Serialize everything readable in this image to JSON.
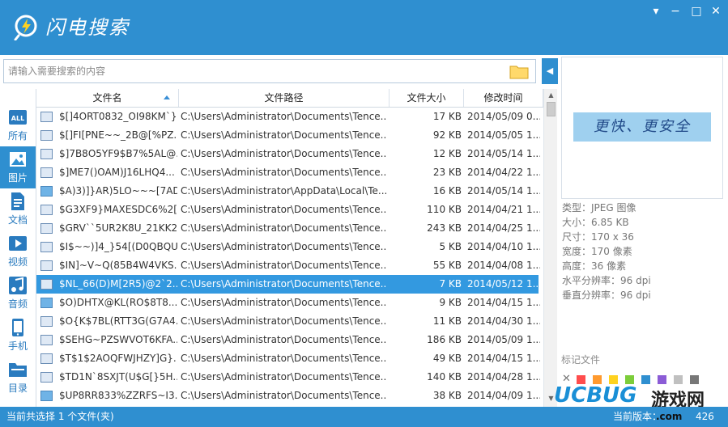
{
  "app": {
    "title": "闪电搜索"
  },
  "search": {
    "placeholder": "请输入需要搜索的内容"
  },
  "sidebar": {
    "items": [
      {
        "label": "所有",
        "icon": "all-icon"
      },
      {
        "label": "图片",
        "icon": "image-icon"
      },
      {
        "label": "文档",
        "icon": "document-icon"
      },
      {
        "label": "视频",
        "icon": "video-icon"
      },
      {
        "label": "音频",
        "icon": "audio-icon"
      },
      {
        "label": "手机",
        "icon": "phone-icon"
      },
      {
        "label": "目录",
        "icon": "folder-icon"
      }
    ],
    "active": "图片"
  },
  "table": {
    "columns": [
      "文件名",
      "文件路径",
      "文件大小",
      "修改时间"
    ],
    "sort_column": "文件名",
    "selected_row": 9,
    "rows": [
      {
        "name": "$[]4ORT0832_OI98KM`}...",
        "path": "C:\\Users\\Administrator\\Documents\\Tence...",
        "size": "17 KB",
        "date": "2014/05/09 0...",
        "type": "file"
      },
      {
        "name": "$[]FI[PNE~~_2B@[%PZ...",
        "path": "C:\\Users\\Administrator\\Documents\\Tence...",
        "size": "92 KB",
        "date": "2014/05/05 1...",
        "type": "file"
      },
      {
        "name": "$]7B8O5YF9$B7%5AL@...",
        "path": "C:\\Users\\Administrator\\Documents\\Tence...",
        "size": "12 KB",
        "date": "2014/05/14 1...",
        "type": "file"
      },
      {
        "name": "$]ME7()OAM)J16LHQ4...",
        "path": "C:\\Users\\Administrator\\Documents\\Tence...",
        "size": "23 KB",
        "date": "2014/04/22 1...",
        "type": "file"
      },
      {
        "name": "$A)3)]}AR)5LO~~~[7AD...",
        "path": "C:\\Users\\Administrator\\AppData\\Local\\Te...",
        "size": "16 KB",
        "date": "2014/05/14 1...",
        "type": "image"
      },
      {
        "name": "$G3XF9}MAXESDC6%2[...",
        "path": "C:\\Users\\Administrator\\Documents\\Tence...",
        "size": "110 KB",
        "date": "2014/04/21 1...",
        "type": "file"
      },
      {
        "name": "$GRV``5UR2K8U_21KK2...",
        "path": "C:\\Users\\Administrator\\Documents\\Tence...",
        "size": "243 KB",
        "date": "2014/04/25 1...",
        "type": "file"
      },
      {
        "name": "$I$~~)]4_}54[(D0QBQU...",
        "path": "C:\\Users\\Administrator\\Documents\\Tence...",
        "size": "5 KB",
        "date": "2014/04/10 1...",
        "type": "file"
      },
      {
        "name": "$IN]~V~Q(85B4W4VKS...",
        "path": "C:\\Users\\Administrator\\Documents\\Tence...",
        "size": "55 KB",
        "date": "2014/04/08 1...",
        "type": "file"
      },
      {
        "name": "$NL_66(D)M[2R5)@2`2...",
        "path": "C:\\Users\\Administrator\\Documents\\Tence...",
        "size": "7 KB",
        "date": "2014/05/12 1...",
        "type": "file"
      },
      {
        "name": "$O)DHTX@KL(RO$8T8...",
        "path": "C:\\Users\\Administrator\\Documents\\Tence...",
        "size": "9 KB",
        "date": "2014/04/15 1...",
        "type": "image"
      },
      {
        "name": "$O{K$7BL(RTT3G(G7A4...",
        "path": "C:\\Users\\Administrator\\Documents\\Tence...",
        "size": "11 KB",
        "date": "2014/04/30 1...",
        "type": "file"
      },
      {
        "name": "$SEHG~PZSWVOT6KFA...",
        "path": "C:\\Users\\Administrator\\Documents\\Tence...",
        "size": "186 KB",
        "date": "2014/05/09 1...",
        "type": "file"
      },
      {
        "name": "$T$1$2AOQFWJHZY]G}...",
        "path": "C:\\Users\\Administrator\\Documents\\Tence...",
        "size": "49 KB",
        "date": "2014/04/15 1...",
        "type": "file"
      },
      {
        "name": "$TD1N`8SXJT(U$G[}5H...",
        "path": "C:\\Users\\Administrator\\Documents\\Tence...",
        "size": "140 KB",
        "date": "2014/04/28 1...",
        "type": "file"
      },
      {
        "name": "$UP8RR833%ZZRFS~I3...",
        "path": "C:\\Users\\Administrator\\Documents\\Tence...",
        "size": "38 KB",
        "date": "2014/04/09 1...",
        "type": "image"
      }
    ]
  },
  "preview": {
    "image_text": "更快、更安全",
    "info": [
      "类型：JPEG 图像",
      "大小：6.85 KB",
      "尺寸：170 x 36",
      "宽度：170 像素",
      "高度：36 像素",
      "水平分辨率：96 dpi",
      "垂直分辨率：96 dpi"
    ],
    "tag_label": "标记文件",
    "tag_colors": [
      "#ff4d4d",
      "#ff9a2e",
      "#ffd21f",
      "#7ccd3a",
      "#2f8fd0",
      "#8b5cd6",
      "#c0c0c0",
      "#777777"
    ]
  },
  "status": {
    "left": "当前共选择 1 个文件(夹)",
    "right": "当前版本：",
    "version_suffix": "426",
    "watermark_domain": ".com"
  },
  "watermark": {
    "brand": "UCBUG",
    "cn": "游戏网"
  }
}
